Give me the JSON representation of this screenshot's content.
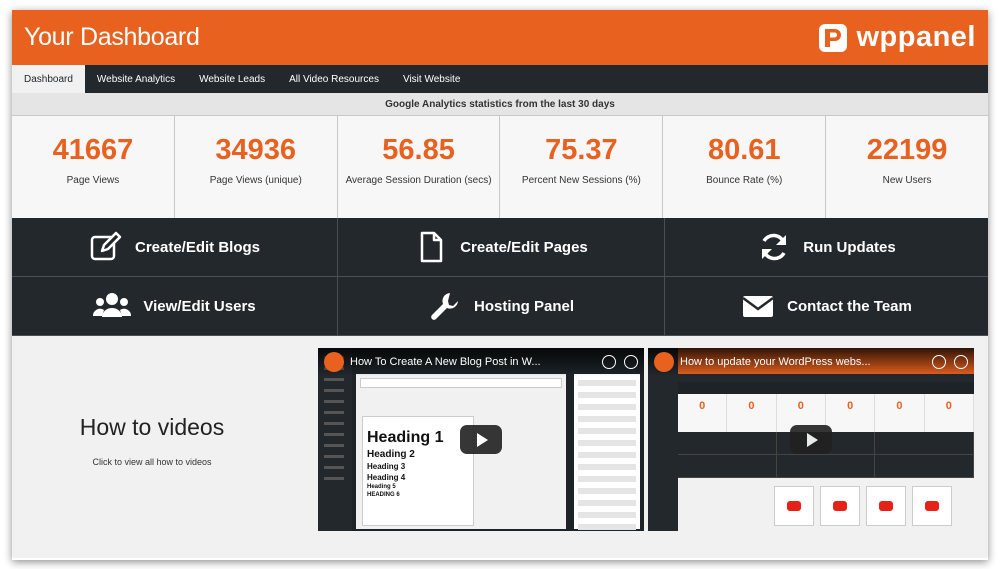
{
  "header": {
    "title": "Your Dashboard",
    "brand_wp": "wp",
    "brand_panel": "panel",
    "accent_color": "#e8611f",
    "dark_color": "#23282d"
  },
  "nav": {
    "tabs": [
      {
        "label": "Dashboard",
        "active": true
      },
      {
        "label": "Website Analytics"
      },
      {
        "label": "Website Leads"
      },
      {
        "label": "All Video Resources"
      },
      {
        "label": "Visit Website"
      }
    ]
  },
  "stats": {
    "caption": "Google Analytics statistics from the last 30 days",
    "items": [
      {
        "value": "41667",
        "label": "Page Views"
      },
      {
        "value": "34936",
        "label": "Page Views (unique)"
      },
      {
        "value": "56.85",
        "label": "Average Session Duration (secs)"
      },
      {
        "value": "75.37",
        "label": "Percent New Sessions (%)"
      },
      {
        "value": "80.61",
        "label": "Bounce Rate (%)"
      },
      {
        "value": "22199",
        "label": "New Users"
      }
    ]
  },
  "actions": [
    {
      "label": "Create/Edit Blogs",
      "icon": "edit-icon"
    },
    {
      "label": "Create/Edit Pages",
      "icon": "page-icon"
    },
    {
      "label": "Run Updates",
      "icon": "refresh-icon"
    },
    {
      "label": "View/Edit Users",
      "icon": "users-icon"
    },
    {
      "label": "Hosting Panel",
      "icon": "wrench-icon"
    },
    {
      "label": "Contact the Team",
      "icon": "envelope-icon"
    }
  ],
  "howto": {
    "title": "How to videos",
    "subtitle": "Click to view all how to videos"
  },
  "videos": [
    {
      "title": "How To Create A New Blog Post in W..."
    },
    {
      "title": "How to update your WordPress webs..."
    }
  ]
}
